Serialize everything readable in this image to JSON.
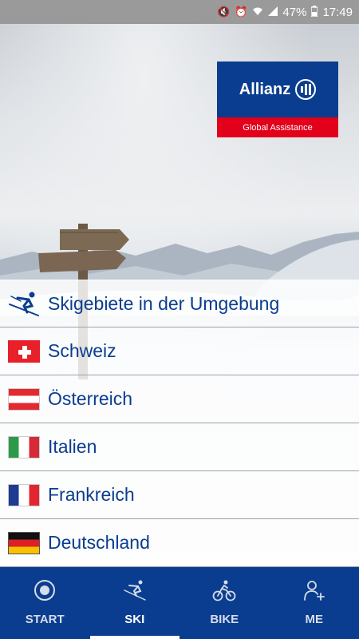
{
  "status_bar": {
    "battery": "47%",
    "time": "17:49",
    "icons": [
      "mute-icon",
      "alarm-icon",
      "wifi-icon",
      "signal-icon",
      "battery-icon"
    ]
  },
  "logo": {
    "brand": "Allianz",
    "subtitle": "Global Assistance",
    "colors": {
      "blue": "#0a3d8f",
      "red": "#e2001a"
    }
  },
  "list": {
    "items": [
      {
        "label": "Skigebiete in der Umgebung",
        "icon": "skier-icon"
      },
      {
        "label": "Schweiz",
        "icon": "flag-switzerland"
      },
      {
        "label": "Österreich",
        "icon": "flag-austria"
      },
      {
        "label": "Italien",
        "icon": "flag-italy"
      },
      {
        "label": "Frankreich",
        "icon": "flag-france"
      },
      {
        "label": "Deutschland",
        "icon": "flag-germany"
      }
    ]
  },
  "bottom_nav": {
    "items": [
      {
        "label": "START",
        "icon": "target-icon"
      },
      {
        "label": "SKI",
        "icon": "skier-icon",
        "active": true
      },
      {
        "label": "BIKE",
        "icon": "bike-icon"
      },
      {
        "label": "ME",
        "icon": "add-person-icon"
      }
    ]
  }
}
